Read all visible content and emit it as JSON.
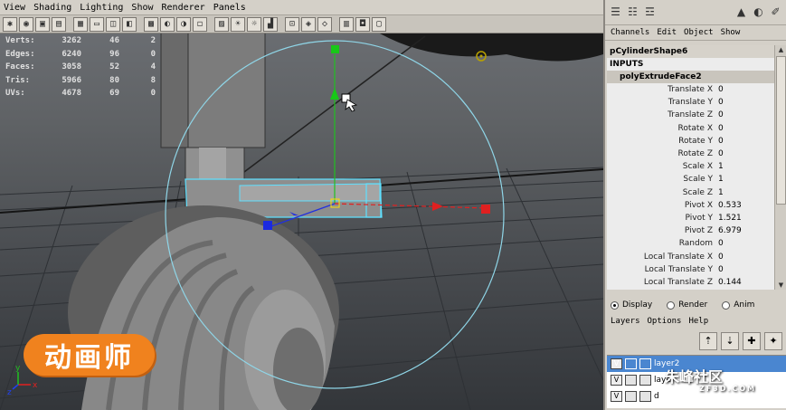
{
  "viewport": {
    "menu": [
      "View",
      "Shading",
      "Lighting",
      "Show",
      "Renderer",
      "Panels"
    ],
    "hud": [
      {
        "label": "Verts:",
        "v1": "3262",
        "v2": "46",
        "v3": "2"
      },
      {
        "label": "Edges:",
        "v1": "6240",
        "v2": "96",
        "v3": "0"
      },
      {
        "label": "Faces:",
        "v1": "3058",
        "v2": "52",
        "v3": "4"
      },
      {
        "label": "Tris:",
        "v1": "5966",
        "v2": "80",
        "v3": "8"
      },
      {
        "label": "UVs:",
        "v1": "4678",
        "v2": "69",
        "v3": "0"
      }
    ],
    "axis_x": "x",
    "axis_y": "y",
    "axis_z": "z",
    "watermark": "动画师",
    "colors": {
      "manip_x": "#e02020",
      "manip_y": "#20c020",
      "manip_z": "#2030e0",
      "selection": "#5ee0ff"
    }
  },
  "channel_box": {
    "menu": [
      "Channels",
      "Edit",
      "Object",
      "Show"
    ],
    "object": "pCylinderShape6",
    "inputs_label": "INPUTS",
    "node": "polyExtrudeFace2",
    "channels": [
      {
        "name": "Translate X",
        "value": "0"
      },
      {
        "name": "Translate Y",
        "value": "0"
      },
      {
        "name": "Translate Z",
        "value": "0"
      },
      {
        "name": "Rotate X",
        "value": "0"
      },
      {
        "name": "Rotate Y",
        "value": "0"
      },
      {
        "name": "Rotate Z",
        "value": "0"
      },
      {
        "name": "Scale X",
        "value": "1"
      },
      {
        "name": "Scale Y",
        "value": "1"
      },
      {
        "name": "Scale Z",
        "value": "1"
      },
      {
        "name": "Pivot X",
        "value": "0.533"
      },
      {
        "name": "Pivot Y",
        "value": "1.521"
      },
      {
        "name": "Pivot Z",
        "value": "6.979"
      },
      {
        "name": "Random",
        "value": "0"
      },
      {
        "name": "Local Translate X",
        "value": "0"
      },
      {
        "name": "Local Translate Y",
        "value": "0"
      },
      {
        "name": "Local Translate Z",
        "value": "0.144"
      }
    ]
  },
  "layer_editor": {
    "modes": [
      "Display",
      "Render",
      "Anim"
    ],
    "menu": [
      "Layers",
      "Options",
      "Help"
    ],
    "layers": [
      {
        "vis": "V",
        "name": "layer2"
      },
      {
        "vis": "V",
        "name": "layer"
      },
      {
        "vis": "V",
        "name": "d"
      }
    ]
  },
  "site_watermark": {
    "title": "朱峰社区",
    "url": "ZF3D.COM"
  }
}
